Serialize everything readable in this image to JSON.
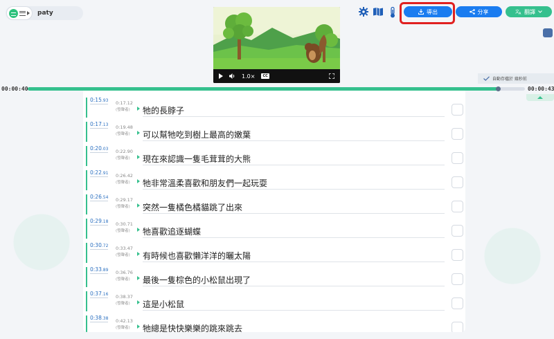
{
  "project": {
    "name": "paty"
  },
  "icons": {
    "logo": "subtitle-app-logo",
    "menu": "hamburger-menu-icon",
    "settings": "gear-icon",
    "map": "book-map-icon",
    "thermo": "thermometer-icon",
    "export": "download-icon",
    "share": "share-icon",
    "translate": "translate-icon"
  },
  "video": {
    "speed": "1.0×",
    "cc": "CC"
  },
  "toolbar": {
    "export_label": "導出",
    "share_label": "分享",
    "translate_label": "翻譯"
  },
  "autosave": {
    "text": "自動存檔於 幾秒前"
  },
  "timeline": {
    "current": "00:00:40",
    "total": "00:00:43",
    "progress": 0.947
  },
  "colors": {
    "accent_green": "#35c08e",
    "accent_blue": "#1a7cf0",
    "highlight_red": "#e02020"
  },
  "subtitles": [
    {
      "start_main": "0:15",
      "start_ms": "93",
      "end": "0:17.12",
      "speaker": "(發聲者)",
      "text": "牠的長脖子"
    },
    {
      "start_main": "0:17",
      "start_ms": "13",
      "end": "0:19.48",
      "speaker": "(發聲者)",
      "text": "可以幫牠吃到樹上最高的嫩葉"
    },
    {
      "start_main": "0:20",
      "start_ms": "03",
      "end": "0:22.90",
      "speaker": "(發聲者)",
      "text": "現在來認識一隻毛茸茸的大熊"
    },
    {
      "start_main": "0:22",
      "start_ms": "91",
      "end": "0:26.42",
      "speaker": "(發聲者)",
      "text": "牠非常溫柔喜歡和朋友們一起玩耍"
    },
    {
      "start_main": "0:26",
      "start_ms": "54",
      "end": "0:29.17",
      "speaker": "(發聲者)",
      "text": "突然一隻橘色橘貓跳了出來"
    },
    {
      "start_main": "0:29",
      "start_ms": "18",
      "end": "0:30.71",
      "speaker": "(發聲者)",
      "text": "牠喜歡追逐蝴蝶"
    },
    {
      "start_main": "0:30",
      "start_ms": "72",
      "end": "0:33.47",
      "speaker": "(發聲者)",
      "text": "有時候也喜歡懶洋洋的曬太陽"
    },
    {
      "start_main": "0:33",
      "start_ms": "89",
      "end": "0:36.76",
      "speaker": "(發聲者)",
      "text": "最後一隻棕色的小松鼠出現了"
    },
    {
      "start_main": "0:37",
      "start_ms": "16",
      "end": "0:38.37",
      "speaker": "(發聲者)",
      "text": "這是小松鼠"
    },
    {
      "start_main": "0:38",
      "start_ms": "38",
      "end": "0:42.13",
      "speaker": "(發聲者)",
      "text": "牠總是快快樂樂的跳來跳去"
    }
  ]
}
